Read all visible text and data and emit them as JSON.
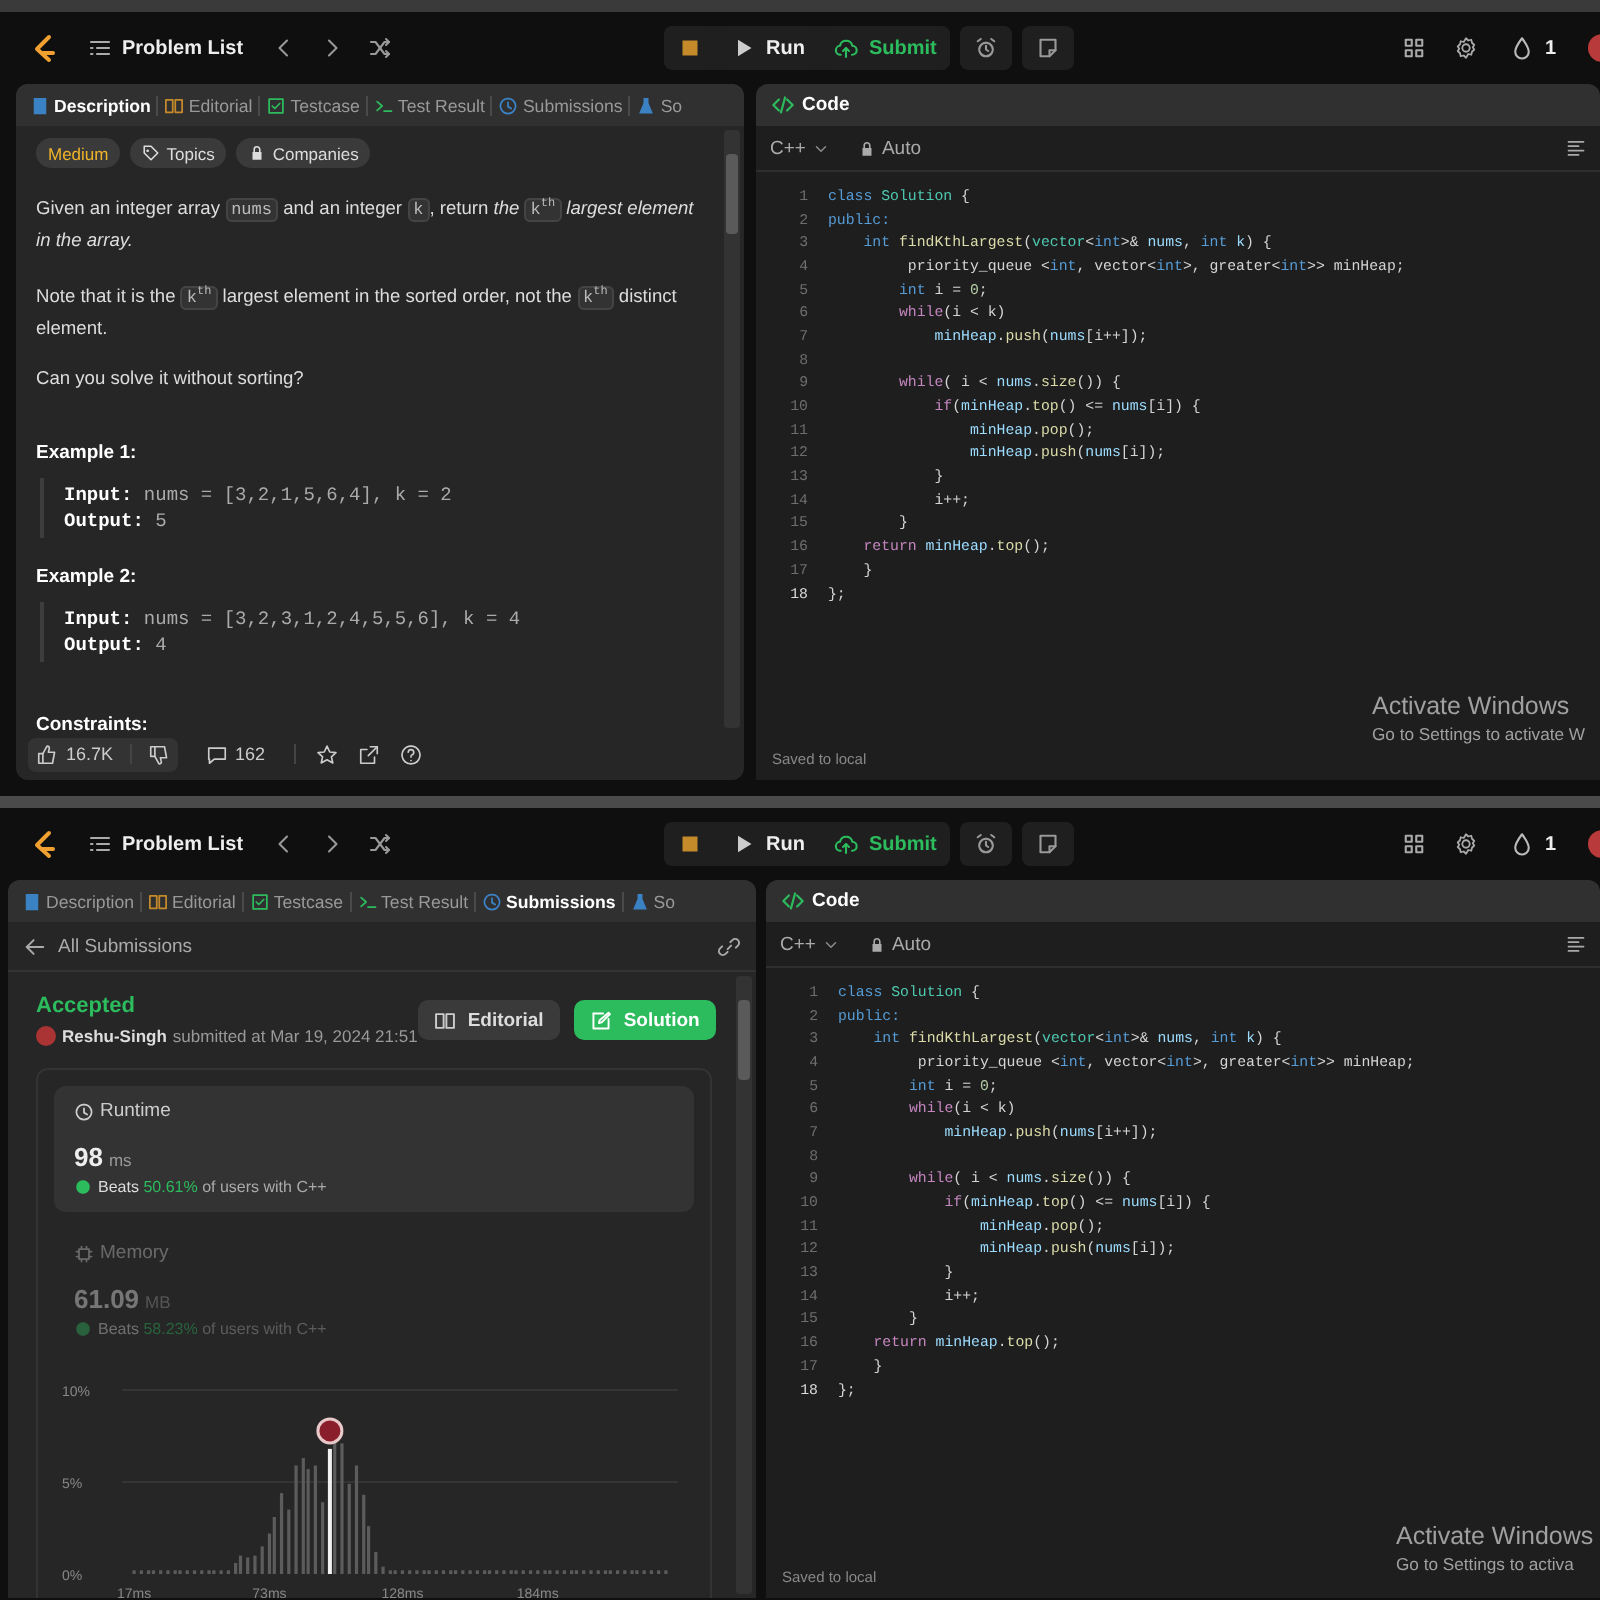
{
  "shots": [
    {
      "topbar": {
        "nav_title": "Problem List",
        "run": "Run",
        "submit": "Submit",
        "streak": "1"
      },
      "left": {
        "kind": "description",
        "tabs": [
          {
            "label": "Description",
            "kind": "description",
            "selected": true
          },
          {
            "label": "Editorial",
            "kind": "editorial",
            "selected": false
          },
          {
            "label": "Testcase",
            "kind": "testcase",
            "selected": false
          },
          {
            "label": "Test Result",
            "kind": "result",
            "selected": false
          },
          {
            "label": "Submissions",
            "kind": "submissions",
            "selected": false
          },
          {
            "label": "So",
            "kind": "solution",
            "selected": false
          }
        ],
        "tags": [
          {
            "label": "Medium",
            "kind": "difficulty"
          },
          {
            "label": "Topics",
            "kind": "topics"
          },
          {
            "label": "Companies",
            "kind": "companies"
          }
        ],
        "paragraphs": [
          [
            {
              "t": "Given an integer array ",
              "kind": "text"
            },
            {
              "t": "nums",
              "kind": "code"
            },
            {
              "t": " and an integer ",
              "kind": "text"
            },
            {
              "t": "k",
              "kind": "code"
            },
            {
              "t": ", return ",
              "kind": "text"
            },
            {
              "t": "the ",
              "kind": "em"
            },
            {
              "t": "k$^{th}$",
              "kind": "code"
            },
            {
              "t": " largest element in the array.",
              "kind": "em"
            }
          ],
          [
            {
              "t": "Note that it is the ",
              "kind": "text"
            },
            {
              "t": "k$^{th}$",
              "kind": "code"
            },
            {
              "t": " largest element in the sorted order, not the ",
              "kind": "text"
            },
            {
              "t": "k$^{th}$",
              "kind": "code"
            },
            {
              "t": " distinct element.",
              "kind": "text"
            }
          ],
          [
            {
              "t": "Can you solve it without sorting?",
              "kind": "text"
            }
          ]
        ],
        "examples": [
          {
            "title": "Example 1:",
            "input_label": "Input:",
            "input": "nums = [3,2,1,5,6,4], k = 2",
            "output_label": "Output:",
            "output": "5"
          },
          {
            "title": "Example 2:",
            "input_label": "Input:",
            "input": "nums = [3,2,3,1,2,4,5,5,6], k = 4",
            "output_label": "Output:",
            "output": "4"
          }
        ],
        "constraints_title": "Constraints:",
        "footer": {
          "likes": "16.7K",
          "comments": "162"
        }
      },
      "code": {
        "title": "Code",
        "language": "C++",
        "mode": "Auto",
        "status": "Saved to local",
        "watermark": {
          "title": "Activate Windows",
          "subtitle": "Go to Settings to activate W"
        },
        "lines": [
          {
            "n": "1",
            "active": false,
            "code": [
              {
                "t": "class",
                "kind": "kw"
              },
              {
                "t": " Solution",
                "kind": "type"
              },
              {
                "t": " {",
                "kind": "p"
              }
            ]
          },
          {
            "n": "2",
            "active": false,
            "code": [
              {
                "t": "public:",
                "kind": "kw"
              }
            ]
          },
          {
            "n": "3",
            "active": false,
            "code": [
              {
                "t": "    int",
                "kind": "kw"
              },
              {
                "t": " findKthLargest",
                "kind": "fn"
              },
              {
                "t": "(",
                "kind": "p"
              },
              {
                "t": "vector",
                "kind": "type"
              },
              {
                "t": "<",
                "kind": "p"
              },
              {
                "t": "int",
                "kind": "kw"
              },
              {
                "t": ">& ",
                "kind": "p"
              },
              {
                "t": "nums",
                "kind": "var"
              },
              {
                "t": ", ",
                "kind": "p"
              },
              {
                "t": "int",
                "kind": "kw"
              },
              {
                "t": " k",
                "kind": "var"
              },
              {
                "t": ") {",
                "kind": "p"
              }
            ]
          },
          {
            "n": "4",
            "active": false,
            "code": [
              {
                "t": "         priority_queue <",
                "kind": "p"
              },
              {
                "t": "int",
                "kind": "kw"
              },
              {
                "t": ", vector<",
                "kind": "p"
              },
              {
                "t": "int",
                "kind": "kw"
              },
              {
                "t": ">, greater<",
                "kind": "p"
              },
              {
                "t": "int",
                "kind": "kw"
              },
              {
                "t": ">> minHeap;",
                "kind": "p"
              }
            ]
          },
          {
            "n": "5",
            "active": false,
            "code": [
              {
                "t": "        int",
                "kind": "kw"
              },
              {
                "t": " i = ",
                "kind": "p"
              },
              {
                "t": "0",
                "kind": "num"
              },
              {
                "t": ";",
                "kind": "p"
              }
            ]
          },
          {
            "n": "6",
            "active": false,
            "code": [
              {
                "t": "        while",
                "kind": "ctl"
              },
              {
                "t": "(i < k)",
                "kind": "p"
              }
            ]
          },
          {
            "n": "7",
            "active": false,
            "code": [
              {
                "t": "            minHeap",
                "kind": "var"
              },
              {
                "t": ".",
                "kind": "p"
              },
              {
                "t": "push",
                "kind": "fn"
              },
              {
                "t": "(",
                "kind": "p"
              },
              {
                "t": "nums",
                "kind": "var"
              },
              {
                "t": "[i++]);",
                "kind": "p"
              }
            ]
          },
          {
            "n": "8",
            "active": false
          },
          {
            "n": "9",
            "active": false,
            "code": [
              {
                "t": "        while",
                "kind": "ctl"
              },
              {
                "t": "( i < ",
                "kind": "p"
              },
              {
                "t": "nums",
                "kind": "var"
              },
              {
                "t": ".",
                "kind": "p"
              },
              {
                "t": "size",
                "kind": "fn"
              },
              {
                "t": "()) {",
                "kind": "p"
              }
            ]
          },
          {
            "n": "10",
            "active": false,
            "code": [
              {
                "t": "            if",
                "kind": "ctl"
              },
              {
                "t": "(",
                "kind": "p"
              },
              {
                "t": "minHeap",
                "kind": "var"
              },
              {
                "t": ".",
                "kind": "p"
              },
              {
                "t": "top",
                "kind": "fn"
              },
              {
                "t": "() <= ",
                "kind": "p"
              },
              {
                "t": "nums",
                "kind": "var"
              },
              {
                "t": "[i]) {",
                "kind": "p"
              }
            ]
          },
          {
            "n": "11",
            "active": false,
            "code": [
              {
                "t": "                minHeap",
                "kind": "var"
              },
              {
                "t": ".",
                "kind": "p"
              },
              {
                "t": "pop",
                "kind": "fn"
              },
              {
                "t": "();",
                "kind": "p"
              }
            ]
          },
          {
            "n": "12",
            "active": false,
            "code": [
              {
                "t": "                minHeap",
                "kind": "var"
              },
              {
                "t": ".",
                "kind": "p"
              },
              {
                "t": "push",
                "kind": "fn"
              },
              {
                "t": "(",
                "kind": "p"
              },
              {
                "t": "nums",
                "kind": "var"
              },
              {
                "t": "[i]);",
                "kind": "p"
              }
            ]
          },
          {
            "n": "13",
            "active": false,
            "code": [
              {
                "t": "            }",
                "kind": "p"
              }
            ]
          },
          {
            "n": "14",
            "active": false,
            "code": [
              {
                "t": "            i++;",
                "kind": "p"
              }
            ]
          },
          {
            "n": "15",
            "active": false,
            "code": [
              {
                "t": "        }",
                "kind": "p"
              }
            ]
          },
          {
            "n": "16",
            "active": false,
            "code": [
              {
                "t": "    return",
                "kind": "ctl"
              },
              {
                "t": " minHeap",
                "kind": "var"
              },
              {
                "t": ".",
                "kind": "p"
              },
              {
                "t": "top",
                "kind": "fn"
              },
              {
                "t": "();",
                "kind": "p"
              }
            ]
          },
          {
            "n": "17",
            "active": false,
            "code": [
              {
                "t": "    }",
                "kind": "p"
              }
            ]
          },
          {
            "n": "18",
            "active": true,
            "code": [
              {
                "t": "};",
                "kind": "p"
              }
            ]
          }
        ]
      }
    },
    {
      "topbar": {
        "nav_title": "Problem List",
        "run": "Run",
        "submit": "Submit",
        "streak": "1"
      },
      "left": {
        "kind": "submission",
        "tabs": [
          {
            "label": "Description",
            "kind": "description",
            "selected": false
          },
          {
            "label": "Editorial",
            "kind": "editorial",
            "selected": false
          },
          {
            "label": "Testcase",
            "kind": "testcase",
            "selected": false
          },
          {
            "label": "Test Result",
            "kind": "result",
            "selected": false
          },
          {
            "label": "Submissions",
            "kind": "submissions",
            "selected": true
          },
          {
            "label": "So",
            "kind": "solution",
            "selected": false
          }
        ],
        "back": "All Submissions",
        "status": "Accepted",
        "user": "Reshu-Singh",
        "submitted": "submitted at Mar 19, 2024 21:51",
        "buttons": [
          {
            "label": "Editorial",
            "kind": "editorial"
          },
          {
            "label": "Solution",
            "kind": "solution"
          }
        ],
        "stats": [
          {
            "kind": "runtime",
            "label": "Runtime",
            "value": "98",
            "unit": "ms",
            "beats": "Beats",
            "percent": "50.61%",
            "suffix": "of users with C++",
            "selected": true
          },
          {
            "kind": "memory",
            "label": "Memory",
            "value": "61.09",
            "unit": "MB",
            "beats": "Beats",
            "percent": "58.23%",
            "suffix": "of users with C++",
            "selected": false
          }
        ],
        "chart_data": {
          "type": "bar",
          "ylim": [
            0,
            10
          ],
          "xlim": [
            12,
            242
          ],
          "yticks": [
            {
              "value": 0,
              "label": "0%"
            },
            {
              "value": 5,
              "label": "5%"
            },
            {
              "value": 10,
              "label": "10%"
            }
          ],
          "xticks": [
            {
              "value": 17,
              "label": "17ms"
            },
            {
              "value": 73,
              "label": "73ms"
            },
            {
              "value": 128,
              "label": "128ms"
            },
            {
              "value": 184,
              "label": "184ms"
            }
          ],
          "x": [
            17,
            20,
            23,
            25,
            28,
            31,
            34,
            36,
            39,
            42,
            45,
            48,
            50,
            53,
            56,
            59,
            61,
            64,
            67,
            70,
            73,
            75,
            78,
            81,
            84,
            87,
            89,
            92,
            95,
            98,
            100,
            103,
            106,
            109,
            112,
            114,
            117,
            120,
            123,
            125,
            128,
            131,
            134,
            137,
            139,
            142,
            145,
            148,
            150,
            153,
            156,
            159,
            162,
            164,
            167,
            170,
            173,
            175,
            178,
            181,
            184,
            187,
            189,
            192,
            195,
            198,
            200,
            203,
            206,
            209,
            212,
            214,
            217,
            220,
            223,
            225,
            228,
            231,
            234,
            237
          ],
          "values": [
            0.2,
            0.2,
            0.2,
            0.2,
            0.2,
            0.2,
            0.2,
            0.2,
            0.2,
            0.2,
            0.2,
            0.2,
            0.2,
            0.2,
            0.2,
            0.6,
            1.0,
            0.9,
            1.0,
            1.5,
            2.2,
            3.1,
            4.4,
            3.5,
            5.9,
            6.3,
            5.7,
            5.9,
            3.9,
            6.8,
            7.3,
            7.1,
            4.9,
            5.9,
            4.3,
            2.6,
            1.2,
            0.4,
            0.2,
            0.2,
            0.2,
            0.2,
            0.2,
            0.2,
            0.2,
            0.2,
            0.2,
            0.2,
            0.2,
            0.2,
            0.2,
            0.2,
            0.2,
            0.2,
            0.2,
            0.2,
            0.2,
            0.2,
            0.2,
            0.2,
            0.2,
            0.2,
            0.2,
            0.2,
            0.2,
            0.2,
            0.2,
            0.2,
            0.2,
            0.2,
            0.2,
            0.2,
            0.2,
            0.2,
            0.2,
            0.2,
            0.2,
            0.2,
            0.2,
            0.2
          ]
        }
      },
      "code": {
        "title": "Code",
        "language": "C++",
        "mode": "Auto",
        "status": "Saved to local",
        "watermark": {
          "title": "Activate Windows",
          "subtitle": "Go to Settings to activa"
        },
        "lines": [
          {
            "n": "1",
            "active": false,
            "code": [
              {
                "t": "class",
                "kind": "kw"
              },
              {
                "t": " Solution",
                "kind": "type"
              },
              {
                "t": " {",
                "kind": "p"
              }
            ]
          },
          {
            "n": "2",
            "active": false,
            "code": [
              {
                "t": "public:",
                "kind": "kw"
              }
            ]
          },
          {
            "n": "3",
            "active": false,
            "code": [
              {
                "t": "    int",
                "kind": "kw"
              },
              {
                "t": " findKthLargest",
                "kind": "fn"
              },
              {
                "t": "(",
                "kind": "p"
              },
              {
                "t": "vector",
                "kind": "type"
              },
              {
                "t": "<",
                "kind": "p"
              },
              {
                "t": "int",
                "kind": "kw"
              },
              {
                "t": ">& ",
                "kind": "p"
              },
              {
                "t": "nums",
                "kind": "var"
              },
              {
                "t": ", ",
                "kind": "p"
              },
              {
                "t": "int",
                "kind": "kw"
              },
              {
                "t": " k",
                "kind": "var"
              },
              {
                "t": ") {",
                "kind": "p"
              }
            ]
          },
          {
            "n": "4",
            "active": false,
            "code": [
              {
                "t": "         priority_queue <",
                "kind": "p"
              },
              {
                "t": "int",
                "kind": "kw"
              },
              {
                "t": ", vector<",
                "kind": "p"
              },
              {
                "t": "int",
                "kind": "kw"
              },
              {
                "t": ">, greater<",
                "kind": "p"
              },
              {
                "t": "int",
                "kind": "kw"
              },
              {
                "t": ">> minHeap;",
                "kind": "p"
              }
            ]
          },
          {
            "n": "5",
            "active": false,
            "code": [
              {
                "t": "        int",
                "kind": "kw"
              },
              {
                "t": " i = ",
                "kind": "p"
              },
              {
                "t": "0",
                "kind": "num"
              },
              {
                "t": ";",
                "kind": "p"
              }
            ]
          },
          {
            "n": "6",
            "active": false,
            "code": [
              {
                "t": "        while",
                "kind": "ctl"
              },
              {
                "t": "(i < k)",
                "kind": "p"
              }
            ]
          },
          {
            "n": "7",
            "active": false,
            "code": [
              {
                "t": "            minHeap",
                "kind": "var"
              },
              {
                "t": ".",
                "kind": "p"
              },
              {
                "t": "push",
                "kind": "fn"
              },
              {
                "t": "(",
                "kind": "p"
              },
              {
                "t": "nums",
                "kind": "var"
              },
              {
                "t": "[i++]);",
                "kind": "p"
              }
            ]
          },
          {
            "n": "8",
            "active": false
          },
          {
            "n": "9",
            "active": false,
            "code": [
              {
                "t": "        while",
                "kind": "ctl"
              },
              {
                "t": "( i < ",
                "kind": "p"
              },
              {
                "t": "nums",
                "kind": "var"
              },
              {
                "t": ".",
                "kind": "p"
              },
              {
                "t": "size",
                "kind": "fn"
              },
              {
                "t": "()) {",
                "kind": "p"
              }
            ]
          },
          {
            "n": "10",
            "active": false,
            "code": [
              {
                "t": "            if",
                "kind": "ctl"
              },
              {
                "t": "(",
                "kind": "p"
              },
              {
                "t": "minHeap",
                "kind": "var"
              },
              {
                "t": ".",
                "kind": "p"
              },
              {
                "t": "top",
                "kind": "fn"
              },
              {
                "t": "() <= ",
                "kind": "p"
              },
              {
                "t": "nums",
                "kind": "var"
              },
              {
                "t": "[i]) {",
                "kind": "p"
              }
            ]
          },
          {
            "n": "11",
            "active": false,
            "code": [
              {
                "t": "                minHeap",
                "kind": "var"
              },
              {
                "t": ".",
                "kind": "p"
              },
              {
                "t": "pop",
                "kind": "fn"
              },
              {
                "t": "();",
                "kind": "p"
              }
            ]
          },
          {
            "n": "12",
            "active": false,
            "code": [
              {
                "t": "                minHeap",
                "kind": "var"
              },
              {
                "t": ".",
                "kind": "p"
              },
              {
                "t": "push",
                "kind": "fn"
              },
              {
                "t": "(",
                "kind": "p"
              },
              {
                "t": "nums",
                "kind": "var"
              },
              {
                "t": "[i]);",
                "kind": "p"
              }
            ]
          },
          {
            "n": "13",
            "active": false,
            "code": [
              {
                "t": "            }",
                "kind": "p"
              }
            ]
          },
          {
            "n": "14",
            "active": false,
            "code": [
              {
                "t": "            i++;",
                "kind": "p"
              }
            ]
          },
          {
            "n": "15",
            "active": false,
            "code": [
              {
                "t": "        }",
                "kind": "p"
              }
            ]
          },
          {
            "n": "16",
            "active": false,
            "code": [
              {
                "t": "    return",
                "kind": "ctl"
              },
              {
                "t": " minHeap",
                "kind": "var"
              },
              {
                "t": ".",
                "kind": "p"
              },
              {
                "t": "top",
                "kind": "fn"
              },
              {
                "t": "();",
                "kind": "p"
              }
            ]
          },
          {
            "n": "17",
            "active": false,
            "code": [
              {
                "t": "    }",
                "kind": "p"
              }
            ]
          },
          {
            "n": "18",
            "active": true,
            "code": [
              {
                "t": "};",
                "kind": "p"
              }
            ]
          }
        ]
      }
    }
  ]
}
